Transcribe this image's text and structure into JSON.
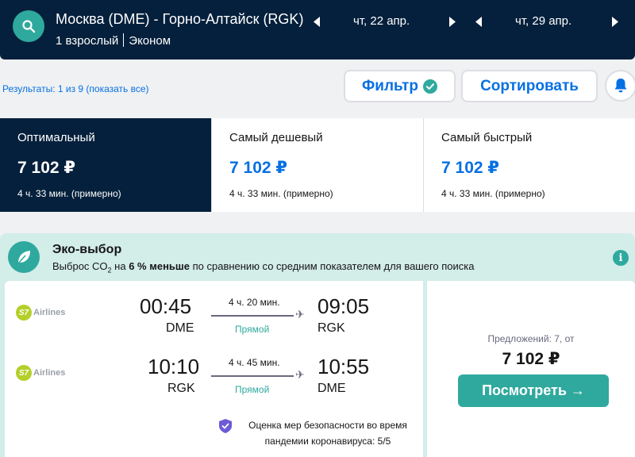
{
  "header": {
    "route": "Москва (DME) - Горно-Алтайск (RGK)",
    "passengers": "1 взрослый",
    "cabin": "Эконом",
    "depart_date": "чт, 22 апр.",
    "return_date": "чт, 29 апр.",
    "icons": [
      "search-icon",
      "arrow-left-icon",
      "arrow-right-icon"
    ]
  },
  "toolbar": {
    "results": "Результаты: 1 из 9 (показать все)",
    "filter_label": "Фильтр",
    "sort_label": "Сортировать"
  },
  "tabs": [
    {
      "label": "Оптимальный",
      "price": "7 102 ₽",
      "duration": "4 ч. 33 мин. (примерно)",
      "active": true
    },
    {
      "label": "Самый дешевый",
      "price": "7 102 ₽",
      "duration": "4 ч. 33 мин. (примерно)",
      "active": false
    },
    {
      "label": "Самый быстрый",
      "price": "7 102 ₽",
      "duration": "4 ч. 33 мин. (примерно)",
      "active": false
    }
  ],
  "eco": {
    "title": "Эко-выбор",
    "desc_pre": "Выброс CO",
    "desc_sub": "2",
    "desc_mid": " на ",
    "desc_bold": "6 % меньше",
    "desc_post": " по сравнению со средним показателем для вашего поиска"
  },
  "legs": [
    {
      "airline": "Airlines",
      "airline_badge": "S7",
      "dep_time": "00:45",
      "dep_code": "DME",
      "duration": "4 ч. 20 мин.",
      "stops": "Прямой",
      "arr_time": "09:05",
      "arr_code": "RGK"
    },
    {
      "airline": "Airlines",
      "airline_badge": "S7",
      "dep_time": "10:10",
      "dep_code": "RGK",
      "duration": "4 ч. 45 мин.",
      "stops": "Прямой",
      "arr_time": "10:55",
      "arr_code": "DME"
    }
  ],
  "safety": {
    "text": "Оценка мер безопасности во время пандемии коронавируса: 5/5"
  },
  "offer": {
    "offers_text": "Предложений: 7, от",
    "price": "7 102 ₽",
    "button_label": "Посмотреть →"
  },
  "colors": {
    "navy": "#05203c",
    "teal": "#2fa99e",
    "blue": "#0770e3",
    "eco_bg": "#d3ede9"
  }
}
